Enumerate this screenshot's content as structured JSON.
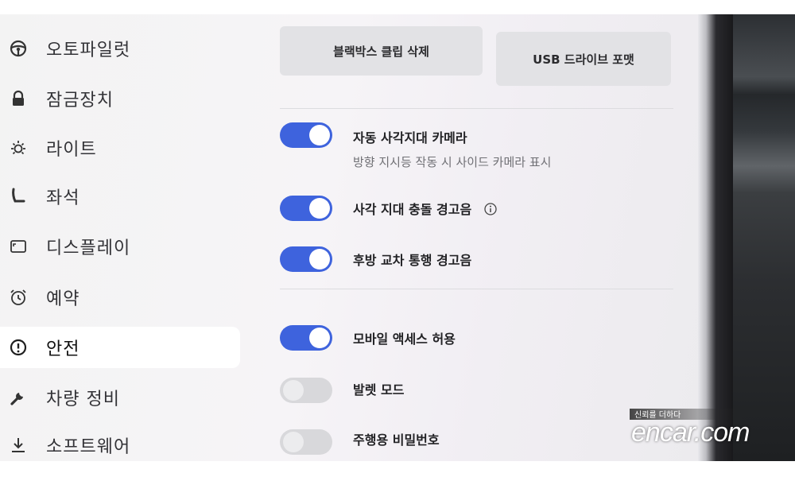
{
  "sidebar": {
    "items": [
      {
        "label": "오토파일럿",
        "icon": "steering-wheel-icon"
      },
      {
        "label": "잠금장치",
        "icon": "lock-icon"
      },
      {
        "label": "라이트",
        "icon": "sun-icon"
      },
      {
        "label": "좌석",
        "icon": "seat-icon"
      },
      {
        "label": "디스플레이",
        "icon": "display-icon"
      },
      {
        "label": "예약",
        "icon": "alarm-clock-icon"
      },
      {
        "label": "안전",
        "icon": "alert-circle-icon",
        "active": true
      },
      {
        "label": "차량 정비",
        "icon": "wrench-icon"
      },
      {
        "label": "소프트웨어",
        "icon": "download-icon"
      }
    ]
  },
  "main": {
    "buttons": {
      "delete_clips": "블랙박스 클립 삭제",
      "format_usb": "USB 드라이브 포맷"
    },
    "settings": {
      "blind_spot_camera": {
        "label": "자동 사각지대 카메라",
        "description": "방향 지시등 작동 시 사이드 카메라 표시",
        "enabled": true
      },
      "blind_spot_chime": {
        "label": "사각 지대 충돌 경고음",
        "enabled": true,
        "icon": "info-icon"
      },
      "rear_cross_traffic": {
        "label": "후방 교차 통행 경고음",
        "enabled": true
      },
      "mobile_access": {
        "label": "모바일 액세스 허용",
        "enabled": true
      },
      "valet_mode": {
        "label": "발렛 모드",
        "enabled": false
      },
      "pin_to_drive": {
        "label": "주행용 비밀번호",
        "enabled": false
      }
    }
  },
  "watermark": {
    "tagline": "신뢰를 더하다",
    "logo": "encar.com"
  },
  "colors": {
    "toggle_on": "#3e63dd",
    "toggle_off": "#d8d8db",
    "sidebar_active": "#ffffff"
  }
}
